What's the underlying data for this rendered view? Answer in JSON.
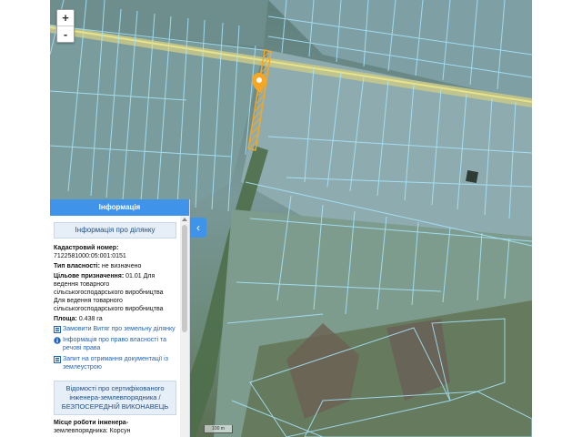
{
  "zoom": {
    "in_label": "+",
    "out_label": "-"
  },
  "panel": {
    "tab_title": "Інформація",
    "collapse_label": "‹",
    "section_parcel": "Інформація про ділянку",
    "cadastral_label": "Кадастровий номер:",
    "cadastral_value": "7122581000:05:001:0151",
    "ownership_label": "Тип власності:",
    "ownership_value": "не визначено",
    "purpose_label": "Цільове призначення:",
    "purpose_value": "01.01 Для ведення товарного сільськогосподарського виробництва",
    "purpose_extra": "Для ведення товарного сільськогосподарського виробництва",
    "area_label": "Площа:",
    "area_value": "0.438 га",
    "link_extract": "Замовити Витяг про земельну ділянку",
    "link_rights": "Інформація про право власності та речові права",
    "link_docs": "Запит на отримання документації із землеустрою",
    "section_engineer": "Відомості про сертифікованого інженера-землевпорядника / БЕЗПОСЕРЕДНІЙ ВИКОНАВЕЦЬ",
    "workplace_label": "Місце роботи інженера-",
    "workplace_tail": "землевпорядника: Корсун"
  },
  "map": {
    "scale_label": "100 m",
    "highlight_color": "#f5a623",
    "parcel_line_color": "#a8e6ff"
  }
}
